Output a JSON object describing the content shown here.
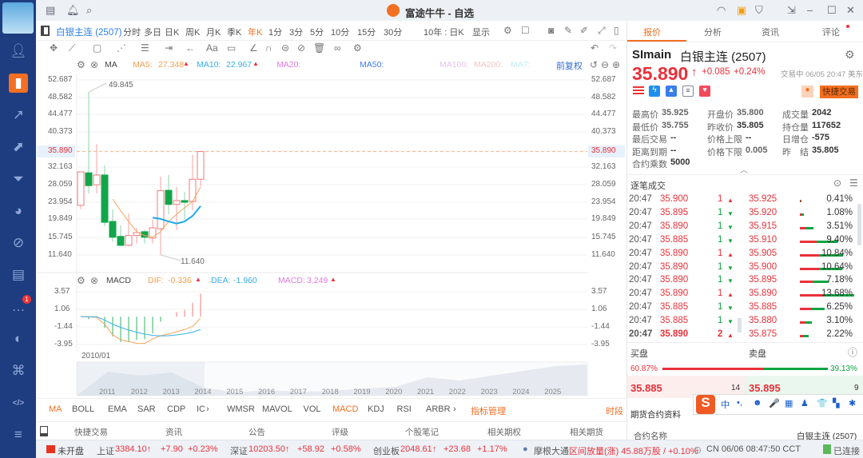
{
  "app": {
    "title": "富途牛牛 - 自选"
  },
  "sidebar": {
    "items": [
      "user-icon",
      "bar-chart-icon",
      "trend-icon",
      "chart-up-icon",
      "funnel-icon",
      "pie-icon",
      "stroke-icon",
      "document-icon",
      "chat-icon",
      "moon-icon",
      "gamepad-icon",
      "code-icon",
      "menu-icon"
    ],
    "active": 1,
    "chat_badge": "1",
    "accent": "#f36f21"
  },
  "toolbar": {
    "symbol": "白银主连 (2507)",
    "periods": [
      "分时",
      "多日",
      "日K",
      "周K",
      "月K",
      "季K",
      "年K",
      "1分",
      "3分",
      "5分",
      "10分",
      "15分",
      "30分"
    ],
    "active_period": "年K",
    "range": "10年 : 日K",
    "display": "显示"
  },
  "legend": {
    "ma": "MA",
    "ma5_label": "MA5:",
    "ma5": "27.348",
    "ma10_label": "MA10:",
    "ma10": "22.967",
    "ma20_label": "MA20:",
    "ma50_label": "MA50:",
    "ma100_label": "MA100:",
    "ma200_label": "MA200:",
    "ma7_label": "MA7:",
    "adjust": "前复权"
  },
  "macd_legend": {
    "name": "MACD",
    "dif_label": "DIF:",
    "dif": "-0.336",
    "dea_label": "DEA:",
    "dea": "-1.960",
    "macd_label": "MACD:",
    "macd": "3.249"
  },
  "axis": {
    "price_ticks": [
      "52.687",
      "48.582",
      "44.477",
      "40.373",
      "35.890",
      "32.163",
      "28.059",
      "23.954",
      "19.849",
      "15.745",
      "11.640"
    ],
    "macd_ticks": [
      "3.57",
      "1.06",
      "-1.44",
      "-3.95"
    ],
    "high_label": "49.845",
    "low_label": "11.640",
    "start_date": "2010/01",
    "years": [
      "2011",
      "2012",
      "2013",
      "2014",
      "2015",
      "2016",
      "2017",
      "2018",
      "2019",
      "2020",
      "2021",
      "2022",
      "2023",
      "2024",
      "2025"
    ]
  },
  "chart_data": {
    "type": "candlestick",
    "candles": [
      [
        23.26,
        31.13,
        31.2,
        22.4
      ],
      [
        30.9,
        27.9,
        49.845,
        26.1
      ],
      [
        28.1,
        30.4,
        37.7,
        26.1
      ],
      [
        30.4,
        19.3,
        32.6,
        18.4
      ],
      [
        19.5,
        15.8,
        22.3,
        14.8
      ],
      [
        16.0,
        13.9,
        18.6,
        13.7
      ],
      [
        13.9,
        16.2,
        21.4,
        13.7
      ],
      [
        16.2,
        16.9,
        18.0,
        14.3
      ],
      [
        17.1,
        15.8,
        17.5,
        14.3
      ],
      [
        15.6,
        18.0,
        19.9,
        14.3
      ],
      [
        17.8,
        26.7,
        30.0,
        11.64
      ],
      [
        26.8,
        23.5,
        30.4,
        21.2
      ],
      [
        23.5,
        24.4,
        27.6,
        17.5
      ],
      [
        24.4,
        24.0,
        26.4,
        19.9
      ],
      [
        24.2,
        29.4,
        35.1,
        22.1
      ],
      [
        29.4,
        35.89,
        35.925,
        27.8
      ]
    ],
    "ma5": [
      null,
      null,
      null,
      null,
      24.76,
      22.0,
      19.5,
      17.1,
      16.2,
      15.8,
      17.1,
      19.5,
      21.2,
      22.7,
      24.2,
      27.6
    ],
    "ma10": [
      null,
      null,
      null,
      null,
      null,
      null,
      null,
      null,
      null,
      20.4,
      20.1,
      19.5,
      19.0,
      19.5,
      20.8,
      23.1
    ],
    "macd_hist": [
      0,
      -0.35,
      0,
      -1.6,
      -2.8,
      -3.6,
      -3.6,
      -3.3,
      -3.2,
      -2.4,
      -0.7,
      0,
      0.65,
      1.0,
      2.0,
      3.3
    ],
    "dif": [
      0,
      0,
      -0.11,
      -1.06,
      -2.58,
      -3.27,
      -3.53,
      -3.8,
      -3.8,
      -3.15,
      -2.7,
      -2.47,
      -2.13,
      -1.82,
      -1.37,
      -0.23
    ],
    "dea": [
      0,
      0,
      0,
      -0.49,
      -1.06,
      -1.52,
      -1.9,
      -2.2,
      -2.47,
      -2.66,
      -2.73,
      -2.7,
      -2.58,
      -2.43,
      -2.2,
      -1.82
    ],
    "current_price": 35.89,
    "ylim": [
      11.64,
      52.687
    ],
    "macd_ylim": [
      -3.95,
      3.57
    ]
  },
  "indicators": {
    "main": [
      "MA",
      "BOLL",
      "EMA",
      "SAR",
      "CDP",
      "IC"
    ],
    "sub": [
      "WMSR",
      "MAVOL",
      "VOL",
      "MACD",
      "KDJ",
      "RSI",
      "ARBR"
    ],
    "manage": "指标管理",
    "period": "时段"
  },
  "bottom_tabs": [
    "快捷交易",
    "资讯",
    "公告",
    "评级",
    "个股笔记",
    "相关期权",
    "相关期货"
  ],
  "quote": {
    "tabs": [
      "报价",
      "分析",
      "资讯",
      "评论"
    ],
    "code": "SImain",
    "name": "白银主连 (2507)",
    "price": "35.890",
    "change": "+0.085",
    "pct": "+0.24%",
    "status": "交易中 06/05 20:47 美东",
    "quick_trade": "快捷交易",
    "fields": [
      [
        "最高价",
        "35.925",
        "red"
      ],
      [
        "开盘价",
        "35.800",
        "green"
      ],
      [
        "成交量",
        "2042",
        ""
      ],
      [
        "最低价",
        "35.755",
        "green"
      ],
      [
        "昨收价",
        "35.805",
        ""
      ],
      [
        "持仓量",
        "117652",
        ""
      ],
      [
        "最后交易",
        "--",
        ""
      ],
      [
        "价格上限",
        "--",
        ""
      ],
      [
        "日增仓",
        "-575",
        ""
      ],
      [
        "距离到期",
        "--",
        ""
      ],
      [
        "价格下限",
        "0.005",
        "green"
      ],
      [
        "昨　结",
        "35.805",
        ""
      ],
      [
        "合约乘数",
        "5000",
        ""
      ]
    ]
  },
  "ticks": {
    "title": "逐笔成交",
    "rows": [
      [
        "20:47",
        "35.900",
        "1",
        "up",
        "35.925",
        "0.41%",
        0.41
      ],
      [
        "20:47",
        "35.895",
        "1",
        "down",
        "35.920",
        "1.08%",
        1.08
      ],
      [
        "20:47",
        "35.890",
        "1",
        "down",
        "35.915",
        "3.51%",
        3.51
      ],
      [
        "20:47",
        "35.885",
        "1",
        "down",
        "35.910",
        "9.40%",
        9.4
      ],
      [
        "20:47",
        "35.890",
        "1",
        "up",
        "35.905",
        "10.84%",
        10.84
      ],
      [
        "20:47",
        "35.890",
        "1",
        "down",
        "35.900",
        "10.64%",
        10.64
      ],
      [
        "20:47",
        "35.890",
        "1",
        "down",
        "35.895",
        "7.18%",
        7.18
      ],
      [
        "20:47",
        "35.890",
        "1",
        "up",
        "35.890",
        "13.68%",
        13.68
      ],
      [
        "20:47",
        "35.885",
        "1",
        "down",
        "35.885",
        "6.25%",
        6.25
      ],
      [
        "20:47",
        "35.885",
        "1",
        "down",
        "35.880",
        "3.10%",
        3.1
      ],
      [
        "20:47",
        "35.890",
        "2",
        "up",
        "35.875",
        "2.22%",
        2.22
      ]
    ]
  },
  "orderbook": {
    "bid_label": "买盘",
    "ask_label": "卖盘",
    "bid_pct": "60.87%",
    "ask_pct": "39.13%",
    "bid_ratio": 60.87,
    "bid": "35.885",
    "bid_vol": "14",
    "ask": "35.895",
    "ask_vol": "9"
  },
  "contract": {
    "title": "期货合约资料",
    "name_label": "合约名称",
    "name": "白银主连 (2507)"
  },
  "ime": {
    "items": [
      "中",
      "•,",
      "☻",
      "🎤",
      "▦",
      "♟",
      "👕",
      "▚",
      "✱"
    ]
  },
  "status": {
    "market": "未开盘",
    "sh_label": "上证",
    "sh": "3384.10↑",
    "sh_chg": "+7.90",
    "sh_pct": "+0.23%",
    "sz_label": "深证",
    "sz": "10203.50↑",
    "sz_chg": "+58.92",
    "sz_pct": "+0.58%",
    "cy_label": "创业板",
    "cy": "2048.61↑",
    "cy_chg": "+23.68",
    "cy_pct": "+1.17%",
    "broker": "摩根大通",
    "broker_note": "区间放量(涨) 45.88万股 / +0.10%",
    "time": "CN 06/06 08:47:50 CCT",
    "conn": "已连接"
  }
}
